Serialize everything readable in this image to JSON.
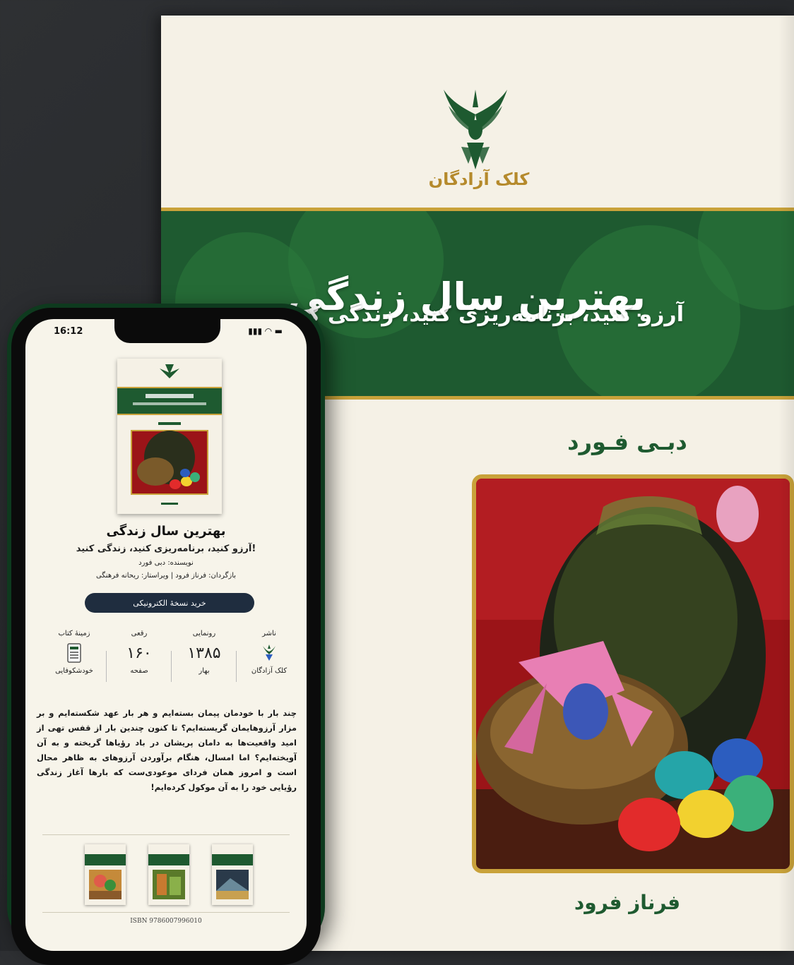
{
  "cover": {
    "publisher": "کلک آزادگان",
    "title": "بهترین سال زندگی",
    "subtitle": "آرزو کنید، برنامه‌ریزی کنید، زندگی کنید!",
    "author": "دبـی فـورد",
    "translator": "فرناز فرود"
  },
  "phone": {
    "status_time": "16:12",
    "status_icons": "▮▮▮ ◠ ▬",
    "book": {
      "title": "بهترین سال زندگی",
      "subtitle": "آرزو کنید، برنامه‌ریزی کنید، زندگی کنید!",
      "author_line": "نویسنده: دبی فورد",
      "credits_line": "بازگردان: فرناز فرود | ویراستار: ریحانه فرهنگی"
    },
    "buy_button": "خرید نسخهٔ الکترونیکی",
    "meta": {
      "publisher": {
        "label": "ناشر",
        "caption": "کلک آزادگان"
      },
      "year": {
        "label": "رونمایی",
        "value": "۱۳۸۵",
        "caption": "بهار"
      },
      "pages": {
        "label": "رقعی",
        "value": "۱۶۰",
        "caption": "صفحه"
      },
      "category": {
        "label": "زمینهٔ کتاب",
        "caption": "خودشکوفایی"
      }
    },
    "description": "چند بار با خودمان پیمان بسته‌ایم و هر بار عهد شکسته‌ایم و بر مزار آرزوهایمان گریسته‌ایم؟ تا کنون چندین بار از قفس تهی از امید واقعیت‌ها به دامان پریشان در باد رؤیاها گریخته و به آن آویخته‌ایم؟ اما امسال، هنگام برآوردن آرزوهای به ظاهر محال است و امروز همان فردای موعودی‌ست که بارها آغاز زندگی رؤیایی خود را به آن موکول کرده‌ایم!",
    "isbn": "ISBN 9786007996010"
  },
  "colors": {
    "green": "#1e5a30",
    "gold": "#c9a23a",
    "cream": "#f5f1e6",
    "navy": "#1f2d3f"
  }
}
